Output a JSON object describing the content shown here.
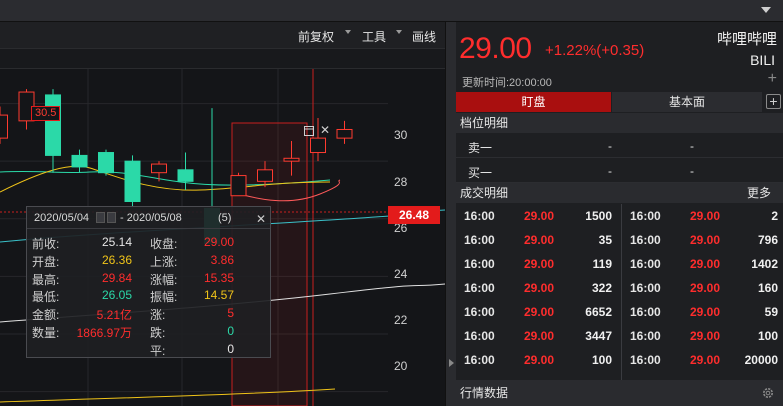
{
  "toolbar": {
    "adjust": "前复权",
    "tools": "工具",
    "draw": "画线"
  },
  "chart": {
    "y_ticks": [
      "30",
      "28",
      "26",
      "24",
      "22",
      "20"
    ],
    "current_price_tag": "26.48",
    "high_flag": "30.5",
    "colors": {
      "up": "#ff3b30",
      "down": "#2bd9a8",
      "ma1": "#f0c419",
      "ma2": "#ff5a5a",
      "ma3": "#2bd9a8",
      "ma4": "#3ac0c8",
      "ma5": "#e0e0e0"
    }
  },
  "chart_data": {
    "type": "candlestick",
    "ylim": [
      19.5,
      31.2
    ],
    "y_ticks": [
      30,
      28,
      26,
      24,
      22,
      20
    ],
    "current_price": 26.48,
    "high_label": 30.5,
    "candles": [
      {
        "open": 28.8,
        "close": 29.6,
        "high": 29.9,
        "low": 28.6
      },
      {
        "open": 29.4,
        "close": 30.4,
        "high": 30.5,
        "low": 29.1
      },
      {
        "open": 30.3,
        "close": 28.2,
        "high": 30.5,
        "low": 27.6
      },
      {
        "open": 28.2,
        "close": 27.8,
        "high": 28.4,
        "low": 27.6
      },
      {
        "open": 28.3,
        "close": 27.6,
        "high": 28.4,
        "low": 27.5
      },
      {
        "open": 28.0,
        "close": 26.6,
        "high": 28.2,
        "low": 26.4
      },
      {
        "open": 27.6,
        "close": 27.9,
        "high": 28.0,
        "low": 27.3
      },
      {
        "open": 27.7,
        "close": 27.3,
        "high": 28.3,
        "low": 27.0
      },
      {
        "open": 26.36,
        "close": 25.14,
        "high": 29.84,
        "low": 26.05
      },
      {
        "open": 26.8,
        "close": 27.5,
        "high": 27.6,
        "low": 26.9
      },
      {
        "open": 27.3,
        "close": 27.7,
        "high": 28.0,
        "low": 27.1
      },
      {
        "open": 28.0,
        "close": 28.1,
        "high": 28.7,
        "low": 27.5
      },
      {
        "open": 28.3,
        "close": 28.8,
        "high": 29.5,
        "low": 28.0
      },
      {
        "open": 28.8,
        "close": 29.1,
        "high": 29.4,
        "low": 28.6
      }
    ]
  },
  "popup": {
    "date_from": "2020/05/04",
    "date_to": "- 2020/05/08",
    "count": "(5)",
    "close": "✕",
    "rows": [
      {
        "l1": "前收:",
        "v1": "25.14",
        "c1": "#e6e6e6",
        "l2": "收盘:",
        "v2": "29.00",
        "c2": "#ff2d2d"
      },
      {
        "l1": "开盘:",
        "v1": "26.36",
        "c1": "#f0c419",
        "l2": "上涨:",
        "v2": "3.86",
        "c2": "#ff2d2d"
      },
      {
        "l1": "最高:",
        "v1": "29.84",
        "c1": "#ff2d2d",
        "l2": "涨幅:",
        "v2": "15.35",
        "c2": "#ff2d2d"
      },
      {
        "l1": "最低:",
        "v1": "26.05",
        "c1": "#2bd9a8",
        "l2": "振幅:",
        "v2": "14.57",
        "c2": "#f0c419"
      },
      {
        "l1": "金额:",
        "v1": "5.21亿",
        "c1": "#ff2d2d",
        "l2": "涨:",
        "v2": "5",
        "c2": "#ff2d2d"
      },
      {
        "l1": "数量:",
        "v1": "1866.97万",
        "c1": "#ff2d2d",
        "l2": "跌:",
        "v2": "0",
        "c2": "#2bd9a8"
      },
      {
        "l1": "",
        "v1": "",
        "c1": "#e6e6e6",
        "l2": "平:",
        "v2": "0",
        "c2": "#e6e6e6"
      }
    ]
  },
  "quote": {
    "price": "29.00",
    "change": "+1.22%(+0.35)",
    "name": "哔哩哔哩",
    "code": "BILI",
    "update_time": "更新时间:20:00:00",
    "plus": "+"
  },
  "tabs": {
    "watch": "盯盘",
    "basic": "基本面",
    "add": "+"
  },
  "orderbook": {
    "title": "档位明细",
    "rows": [
      {
        "side": "卖一",
        "price": "-",
        "vol": "-"
      },
      {
        "side": "买一",
        "price": "-",
        "vol": "-"
      }
    ]
  },
  "trades": {
    "title": "成交明细",
    "more": "更多",
    "left": [
      {
        "time": "16:00",
        "price": "29.00",
        "vol": "1500"
      },
      {
        "time": "16:00",
        "price": "29.00",
        "vol": "35"
      },
      {
        "time": "16:00",
        "price": "29.00",
        "vol": "119"
      },
      {
        "time": "16:00",
        "price": "29.00",
        "vol": "322"
      },
      {
        "time": "16:00",
        "price": "29.00",
        "vol": "6652"
      },
      {
        "time": "16:00",
        "price": "29.00",
        "vol": "3447"
      },
      {
        "time": "16:00",
        "price": "29.00",
        "vol": "100"
      }
    ],
    "right": [
      {
        "time": "16:00",
        "price": "29.00",
        "vol": "2"
      },
      {
        "time": "16:00",
        "price": "29.00",
        "vol": "796"
      },
      {
        "time": "16:00",
        "price": "29.00",
        "vol": "1402"
      },
      {
        "time": "16:00",
        "price": "29.00",
        "vol": "160"
      },
      {
        "time": "16:00",
        "price": "29.00",
        "vol": "59"
      },
      {
        "time": "16:00",
        "price": "29.00",
        "vol": "100"
      },
      {
        "time": "16:00",
        "price": "29.00",
        "vol": "20000"
      }
    ]
  },
  "market": {
    "title": "行情数据"
  }
}
